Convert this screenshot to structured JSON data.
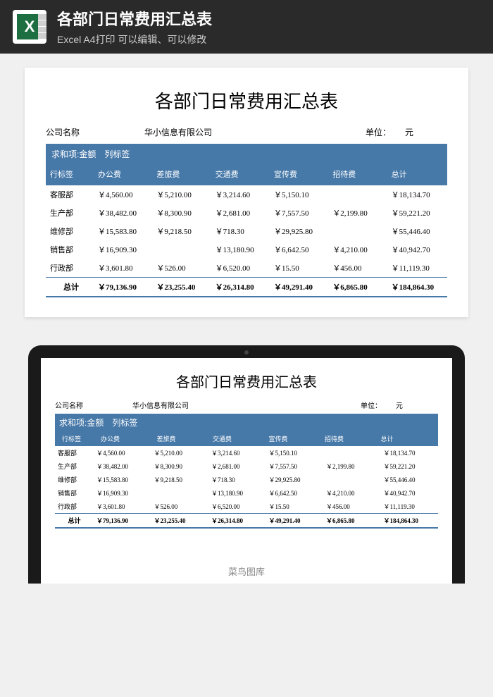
{
  "header": {
    "title": "各部门日常费用汇总表",
    "subtitle": "Excel A4打印 可以编辑、可以修改",
    "icon_letter": "X"
  },
  "doc": {
    "title": "各部门日常费用汇总表",
    "company_label": "公司名称",
    "company_name": "华小信息有限公司",
    "unit_label": "单位：",
    "unit_value": "元",
    "pivot_measure": "求和项:金额",
    "pivot_col_label": "列标签",
    "row_label_header": "行标签",
    "columns": [
      "办公费",
      "差旅费",
      "交通费",
      "宣传费",
      "招待费",
      "总计"
    ],
    "rows": [
      {
        "label": "客服部",
        "cells": [
          "￥4,560.00",
          "￥5,210.00",
          "￥3,214.60",
          "￥5,150.10",
          "",
          "￥18,134.70"
        ]
      },
      {
        "label": "生产部",
        "cells": [
          "￥38,482.00",
          "￥8,300.90",
          "￥2,681.00",
          "￥7,557.50",
          "￥2,199.80",
          "￥59,221.20"
        ]
      },
      {
        "label": "维修部",
        "cells": [
          "￥15,583.80",
          "￥9,218.50",
          "￥718.30",
          "￥29,925.80",
          "",
          "￥55,446.40"
        ]
      },
      {
        "label": "销售部",
        "cells": [
          "￥16,909.30",
          "",
          "￥13,180.90",
          "￥6,642.50",
          "￥4,210.00",
          "￥40,942.70"
        ]
      },
      {
        "label": "行政部",
        "cells": [
          "￥3,601.80",
          "￥526.00",
          "￥6,520.00",
          "￥15.50",
          "￥456.00",
          "￥11,119.30"
        ]
      }
    ],
    "total_label": "总计",
    "totals": [
      "￥79,136.90",
      "￥23,255.40",
      "￥26,314.80",
      "￥49,291.40",
      "￥6,865.80",
      "￥184,864.30"
    ]
  },
  "watermark": "菜鸟图库"
}
